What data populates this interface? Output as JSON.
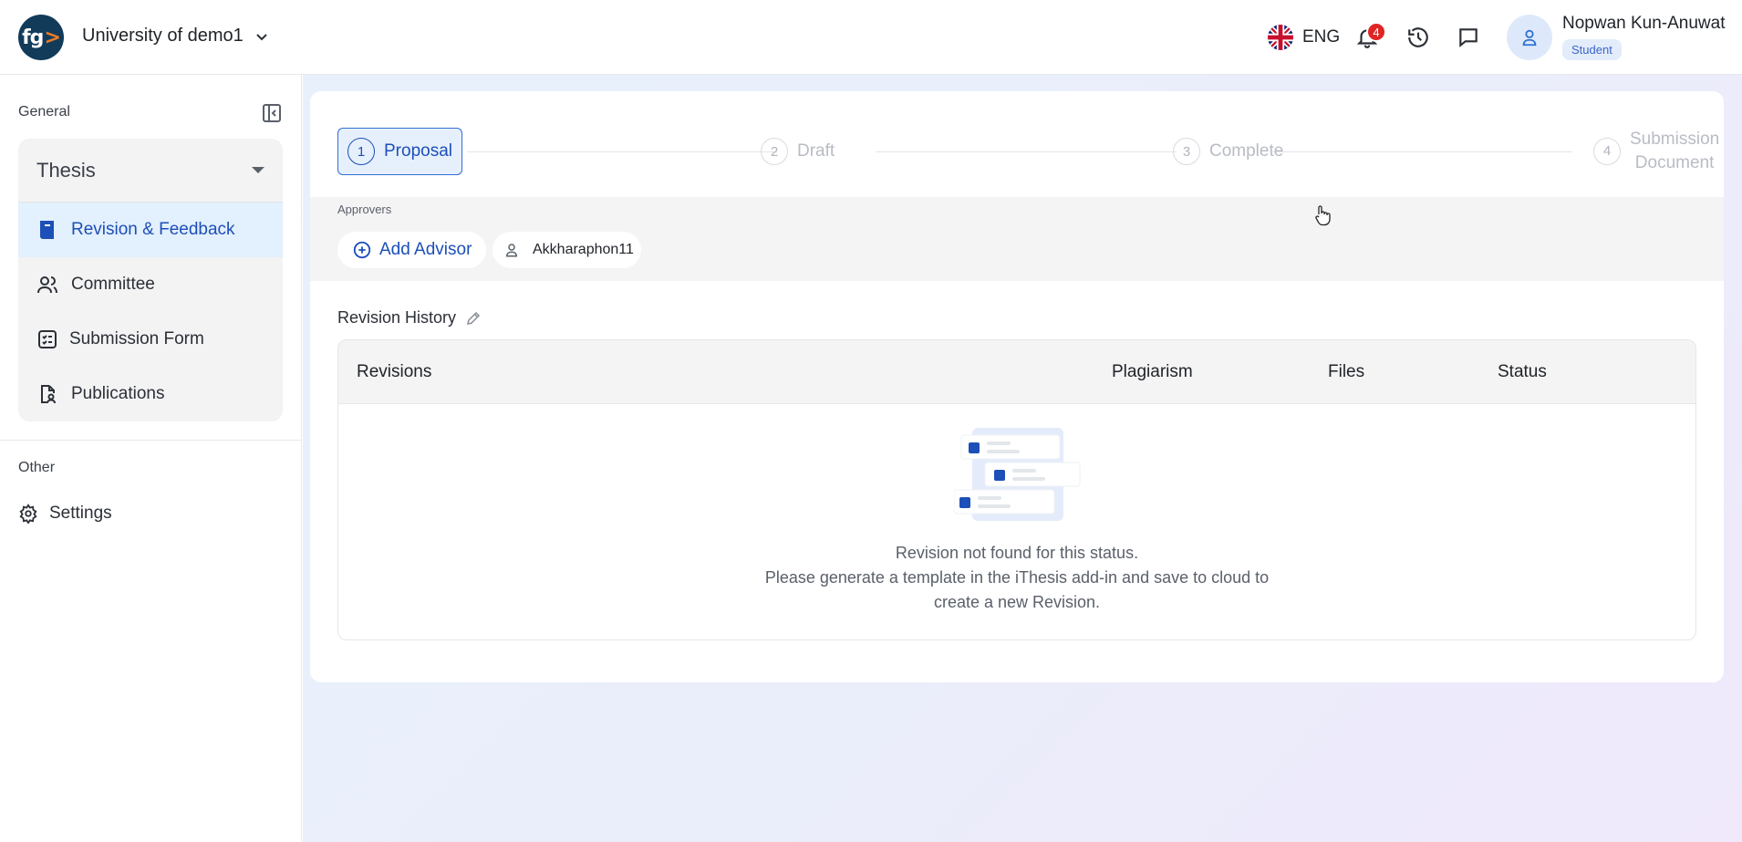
{
  "header": {
    "logo_text": "fg",
    "org_name": "University of demo1",
    "language": "ENG",
    "notification_count": "4",
    "user_name": "Nopwan Kun-Anuwat",
    "user_role": "Student"
  },
  "sidebar": {
    "general_label": "General",
    "group_title": "Thesis",
    "items": [
      {
        "label": "Revision & Feedback",
        "icon": "book-icon",
        "active": true
      },
      {
        "label": "Committee",
        "icon": "users-icon"
      },
      {
        "label": "Submission Form",
        "icon": "checklist-icon"
      },
      {
        "label": "Publications",
        "icon": "document-user-icon"
      }
    ],
    "other_label": "Other",
    "settings_label": "Settings"
  },
  "stepper": {
    "steps": [
      {
        "num": "1",
        "label": "Proposal",
        "active": true
      },
      {
        "num": "2",
        "label": "Draft"
      },
      {
        "num": "3",
        "label": "Complete"
      },
      {
        "num": "4",
        "label": "Submission Document",
        "label_line1": "Submission",
        "label_line2": "Document"
      }
    ]
  },
  "approvers": {
    "label": "Approvers",
    "add_advisor": "Add Advisor",
    "advisor_name": "Akkharaphon11"
  },
  "revision_history": {
    "title": "Revision History",
    "columns": [
      "Revisions",
      "Plagiarism",
      "Files",
      "Status"
    ],
    "empty_line1": "Revision not found for this status.",
    "empty_line2": "Please generate a template in the iThesis add-in and save to cloud to",
    "empty_line3": "create a new Revision."
  },
  "colors": {
    "primary": "#1c4fb8",
    "logo_bg": "#123b5a",
    "logo_accent": "#f07a22",
    "badge": "#e02424"
  }
}
